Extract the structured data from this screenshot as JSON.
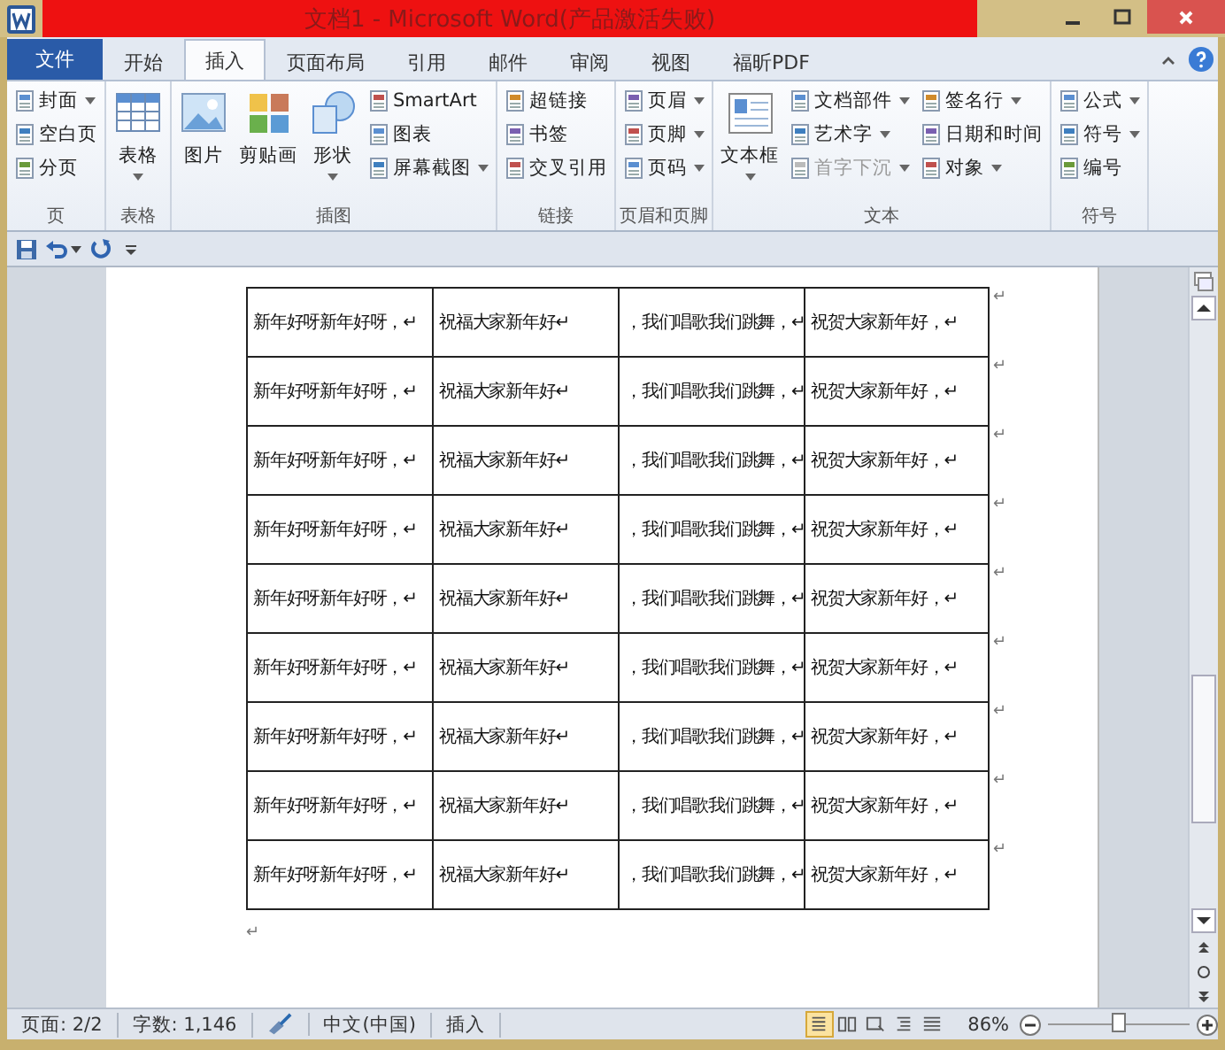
{
  "window": {
    "title": "文档1 - Microsoft Word(产品激活失败)"
  },
  "tabs": [
    {
      "label": "文件",
      "kind": "file",
      "selected": false
    },
    {
      "label": "开始",
      "kind": "tab",
      "selected": false
    },
    {
      "label": "插入",
      "kind": "tab",
      "selected": true
    },
    {
      "label": "页面布局",
      "kind": "tab",
      "selected": false
    },
    {
      "label": "引用",
      "kind": "tab",
      "selected": false
    },
    {
      "label": "邮件",
      "kind": "tab",
      "selected": false
    },
    {
      "label": "审阅",
      "kind": "tab",
      "selected": false
    },
    {
      "label": "视图",
      "kind": "tab",
      "selected": false
    },
    {
      "label": "福昕PDF",
      "kind": "tab",
      "selected": false
    }
  ],
  "ribbon_groups": [
    {
      "label": "页",
      "items": [
        {
          "label": "封面",
          "kind": "small",
          "dropdown": true,
          "disabled": false
        },
        {
          "label": "空白页",
          "kind": "small",
          "dropdown": false,
          "disabled": false
        },
        {
          "label": "分页",
          "kind": "small",
          "dropdown": false,
          "disabled": false
        }
      ]
    },
    {
      "label": "表格",
      "items": [
        {
          "label": "表格",
          "kind": "large",
          "dropdown": true,
          "disabled": false
        }
      ]
    },
    {
      "label": "插图",
      "items": [
        {
          "label": "图片",
          "kind": "large",
          "dropdown": false,
          "disabled": false
        },
        {
          "label": "剪贴画",
          "kind": "large",
          "dropdown": false,
          "disabled": false
        },
        {
          "label": "形状",
          "kind": "large",
          "dropdown": true,
          "disabled": false
        },
        {
          "label": "SmartArt",
          "kind": "small",
          "dropdown": false,
          "disabled": false
        },
        {
          "label": "图表",
          "kind": "small",
          "dropdown": false,
          "disabled": false
        },
        {
          "label": "屏幕截图",
          "kind": "small",
          "dropdown": true,
          "disabled": false
        }
      ]
    },
    {
      "label": "链接",
      "items": [
        {
          "label": "超链接",
          "kind": "small",
          "dropdown": false,
          "disabled": false
        },
        {
          "label": "书签",
          "kind": "small",
          "dropdown": false,
          "disabled": false
        },
        {
          "label": "交叉引用",
          "kind": "small",
          "dropdown": false,
          "disabled": false
        }
      ]
    },
    {
      "label": "页眉和页脚",
      "items": [
        {
          "label": "页眉",
          "kind": "small",
          "dropdown": true,
          "disabled": false
        },
        {
          "label": "页脚",
          "kind": "small",
          "dropdown": true,
          "disabled": false
        },
        {
          "label": "页码",
          "kind": "small",
          "dropdown": true,
          "disabled": false
        }
      ]
    },
    {
      "label": "文本",
      "items": [
        {
          "label": "文本框",
          "kind": "large",
          "dropdown": true,
          "disabled": false
        },
        {
          "label": "文档部件",
          "kind": "small",
          "dropdown": true,
          "disabled": false
        },
        {
          "label": "艺术字",
          "kind": "small",
          "dropdown": true,
          "disabled": false
        },
        {
          "label": "首字下沉",
          "kind": "small",
          "dropdown": true,
          "disabled": true
        },
        {
          "label": "签名行",
          "kind": "small",
          "dropdown": true,
          "disabled": false
        },
        {
          "label": "日期和时间",
          "kind": "small",
          "dropdown": false,
          "disabled": false
        },
        {
          "label": "对象",
          "kind": "small",
          "dropdown": true,
          "disabled": false
        }
      ]
    },
    {
      "label": "符号",
      "items": [
        {
          "label": "公式",
          "kind": "small",
          "dropdown": true,
          "disabled": false
        },
        {
          "label": "符号",
          "kind": "small",
          "dropdown": true,
          "disabled": false
        },
        {
          "label": "编号",
          "kind": "small",
          "dropdown": false,
          "disabled": false
        }
      ]
    }
  ],
  "table": {
    "rows": [
      {
        "cells": [
          "新年好呀新年好呀，↵",
          "祝福大家新年好↵",
          "，我们唱歌我们跳舞，↵",
          "祝贺大家新年好，↵"
        ],
        "end_mark": "↵"
      },
      {
        "cells": [
          "新年好呀新年好呀，↵",
          "祝福大家新年好↵",
          "，我们唱歌我们跳舞，↵",
          "祝贺大家新年好，↵"
        ],
        "end_mark": "↵"
      },
      {
        "cells": [
          "新年好呀新年好呀，↵",
          "祝福大家新年好↵",
          "，我们唱歌我们跳舞，↵",
          "祝贺大家新年好，↵"
        ],
        "end_mark": "↵"
      },
      {
        "cells": [
          "新年好呀新年好呀，↵",
          "祝福大家新年好↵",
          "，我们唱歌我们跳舞，↵",
          "祝贺大家新年好，↵"
        ],
        "end_mark": "↵"
      },
      {
        "cells": [
          "新年好呀新年好呀，↵",
          "祝福大家新年好↵",
          "，我们唱歌我们跳舞，↵",
          "祝贺大家新年好，↵"
        ],
        "end_mark": "↵"
      },
      {
        "cells": [
          "新年好呀新年好呀，↵",
          "祝福大家新年好↵",
          "，我们唱歌我们跳舞，↵",
          "祝贺大家新年好，↵"
        ],
        "end_mark": "↵"
      },
      {
        "cells": [
          "新年好呀新年好呀，↵",
          "祝福大家新年好↵",
          "，我们唱歌我们跳舞，↵",
          "祝贺大家新年好，↵"
        ],
        "end_mark": "↵"
      },
      {
        "cells": [
          "新年好呀新年好呀，↵",
          "祝福大家新年好↵",
          "，我们唱歌我们跳舞，↵",
          "祝贺大家新年好，↵"
        ],
        "end_mark": "↵"
      },
      {
        "cells": [
          "新年好呀新年好呀，↵",
          "祝福大家新年好↵",
          "，我们唱歌我们跳舞，↵",
          "祝贺大家新年好，↵"
        ],
        "end_mark": "↵"
      }
    ]
  },
  "after_table_mark": "↵",
  "status_bar": {
    "page": "页面: 2/2",
    "words": "字数: 1,146",
    "language": "中文(中国)",
    "mode": "插入",
    "views": [
      {
        "selected": true
      },
      {
        "selected": false
      },
      {
        "selected": false
      },
      {
        "selected": false
      },
      {
        "selected": false
      }
    ],
    "zoom": "86%",
    "zoom_level": {
      "level": 0.5
    }
  }
}
